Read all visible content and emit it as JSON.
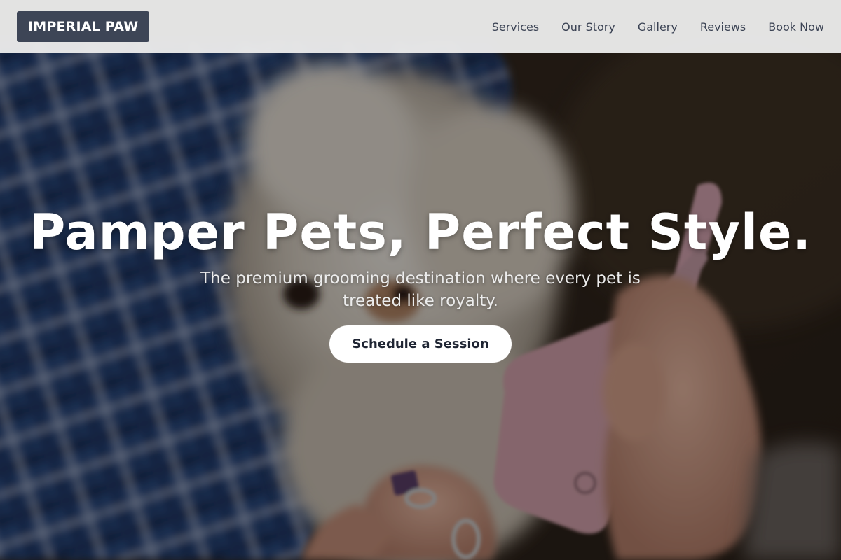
{
  "header": {
    "logo_text": "IMPERIAL PAW",
    "nav": [
      {
        "label": "Services"
      },
      {
        "label": "Our Story"
      },
      {
        "label": "Gallery"
      },
      {
        "label": "Reviews"
      },
      {
        "label": "Book Now"
      }
    ]
  },
  "hero": {
    "title": "Pamper Pets, Perfect Style.",
    "subtitle": "The premium grooming destination where every pet is treated like royalty.",
    "cta_label": "Schedule a Session"
  },
  "colors": {
    "header_bg": "#ebebeb",
    "logo_bg": "#3d4556",
    "nav_text": "#3b4354",
    "cta_bg": "#ffffff",
    "cta_text": "#1f2533"
  }
}
